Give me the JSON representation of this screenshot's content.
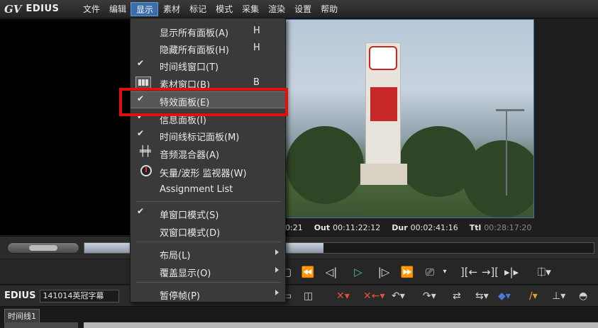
{
  "app": {
    "logo": "EDIUS",
    "logo_mark": "GV"
  },
  "menubar": {
    "items": [
      "文件",
      "编辑",
      "显示",
      "素材",
      "标记",
      "模式",
      "采集",
      "渲染",
      "设置",
      "帮助"
    ],
    "active_index": 2
  },
  "display_menu": {
    "items": [
      {
        "label": "显示所有面板(A)",
        "shortcut": "H",
        "checked": false
      },
      {
        "label": "隐藏所有面板(H)",
        "shortcut": "H",
        "checked": false
      },
      {
        "label": "时间线窗口(T)",
        "shortcut": "",
        "checked": true
      },
      {
        "label": "素材窗口(B)",
        "shortcut": "B",
        "checked": false,
        "icon": "bin-window-icon"
      },
      {
        "label": "特效面板(E)",
        "shortcut": "",
        "checked": true,
        "highlighted": true
      },
      {
        "label": "信息面板(I)",
        "shortcut": "",
        "checked": true
      },
      {
        "label": "时间线标记面板(M)",
        "shortcut": "",
        "checked": true
      },
      {
        "label": "音频混合器(A)",
        "shortcut": "",
        "checked": false,
        "icon": "audio-mixer-icon"
      },
      {
        "label": "矢量/波形 监视器(W)",
        "shortcut": "",
        "checked": false,
        "icon": "vectorscope-icon"
      },
      {
        "label": "Assignment List",
        "shortcut": "",
        "checked": false
      },
      {
        "label": "单窗口模式(S)",
        "shortcut": "",
        "checked": true
      },
      {
        "label": "双窗口模式(D)",
        "shortcut": "",
        "checked": false
      },
      {
        "label": "布局(L)",
        "submenu": true
      },
      {
        "label": "覆盖显示(O)",
        "submenu": true
      },
      {
        "label": "暂停帧(P)",
        "submenu": true
      }
    ]
  },
  "player": {
    "timecode_partial": "0:21",
    "out_label": "Out",
    "out_value": "00:11:22:12",
    "dur_label": "Dur",
    "dur_value": "00:02:41:16",
    "ttl_label": "Ttl",
    "ttl_value": "00:28:17:20",
    "scrub_progress": 0.47
  },
  "toolbar": {
    "logo": "EDIUS",
    "project_name": "141014英冠字幕"
  },
  "timeline": {
    "tab_label": "时间线1"
  },
  "colors": {
    "menu_active": "#3a6ea8",
    "annotation_red": "#e01010",
    "timecode_play": "#4fbfa0"
  }
}
